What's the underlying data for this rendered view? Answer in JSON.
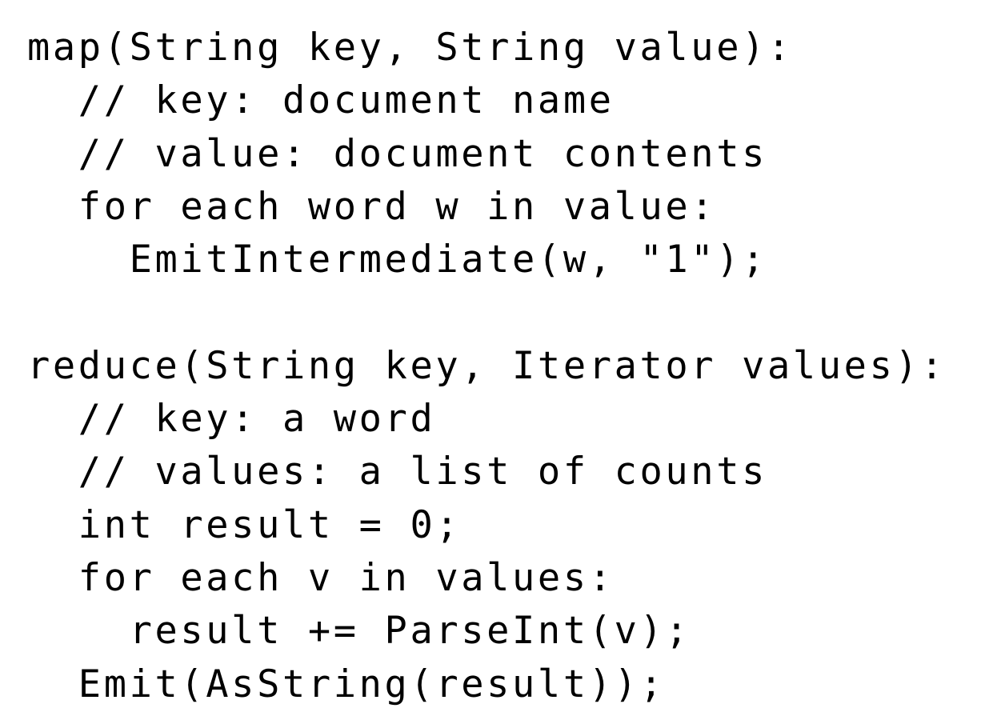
{
  "document": {
    "kind": "code-listing",
    "language": "pseudocode",
    "background_color": "#ffffff",
    "text_color": "#000000"
  },
  "code": {
    "lines": [
      "map(String key, String value):",
      "  // key: document name",
      "  // value: document contents",
      "  for each word w in value:",
      "    EmitIntermediate(w, \"1\");",
      "",
      "reduce(String key, Iterator values):",
      "  // key: a word",
      "  // values: a list of counts",
      "  int result = 0;",
      "  for each v in values:",
      "    result += ParseInt(v);",
      "  Emit(AsString(result));"
    ]
  }
}
